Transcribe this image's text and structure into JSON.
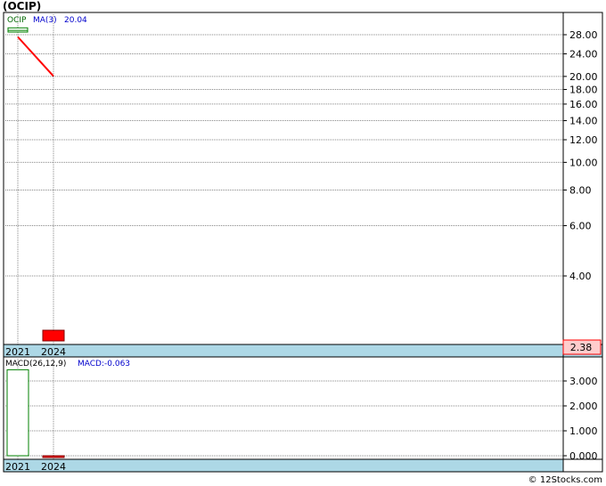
{
  "title": "(OCIP)",
  "footer": "© 12Stocks.com",
  "colors": {
    "up": "#008000",
    "down": "#ff0000",
    "band": "#add8e6",
    "grid": "#888888",
    "legend_text": "#0000cc"
  },
  "chart_data": [
    {
      "type": "candlestick",
      "symbol": "OCIP",
      "legend": {
        "symbol_label": "OCIP",
        "ma_label": "MA(3)",
        "ma_value": "20.04"
      },
      "x": [
        "2021",
        "2024"
      ],
      "x_labels": [
        "2021",
        "2024"
      ],
      "candles": [
        {
          "x": "2021",
          "open": 29.0,
          "high": 29.6,
          "low": 28.6,
          "close": 29.0,
          "color": "green"
        },
        {
          "x": "2024",
          "open": 2.75,
          "high": 2.75,
          "low": 2.45,
          "close": 2.45,
          "color": "red"
        }
      ],
      "ma": {
        "name": "MA(3)",
        "points": [
          {
            "x": "2021",
            "y": 27.5
          },
          {
            "x": "2024",
            "y": 20.04
          }
        ]
      },
      "y_scale": "log",
      "ylim": [
        2.38,
        32
      ],
      "y_ticks": [
        "28.00",
        "24.00",
        "20.00",
        "18.00",
        "16.00",
        "14.00",
        "12.00",
        "10.00",
        "8.00",
        "6.00",
        "4.00"
      ],
      "last_price": "2.38",
      "grid": true
    },
    {
      "type": "bar",
      "label": "MACD(26,12,9)",
      "value_label": "MACD:-0.063",
      "x": [
        "2021",
        "2024"
      ],
      "x_labels": [
        "2021",
        "2024"
      ],
      "values": [
        3.45,
        -0.063
      ],
      "ylim": [
        -0.2,
        3.5
      ],
      "y_ticks": [
        "3.000",
        "2.000",
        "1.000",
        "0.000"
      ],
      "grid": true
    }
  ]
}
